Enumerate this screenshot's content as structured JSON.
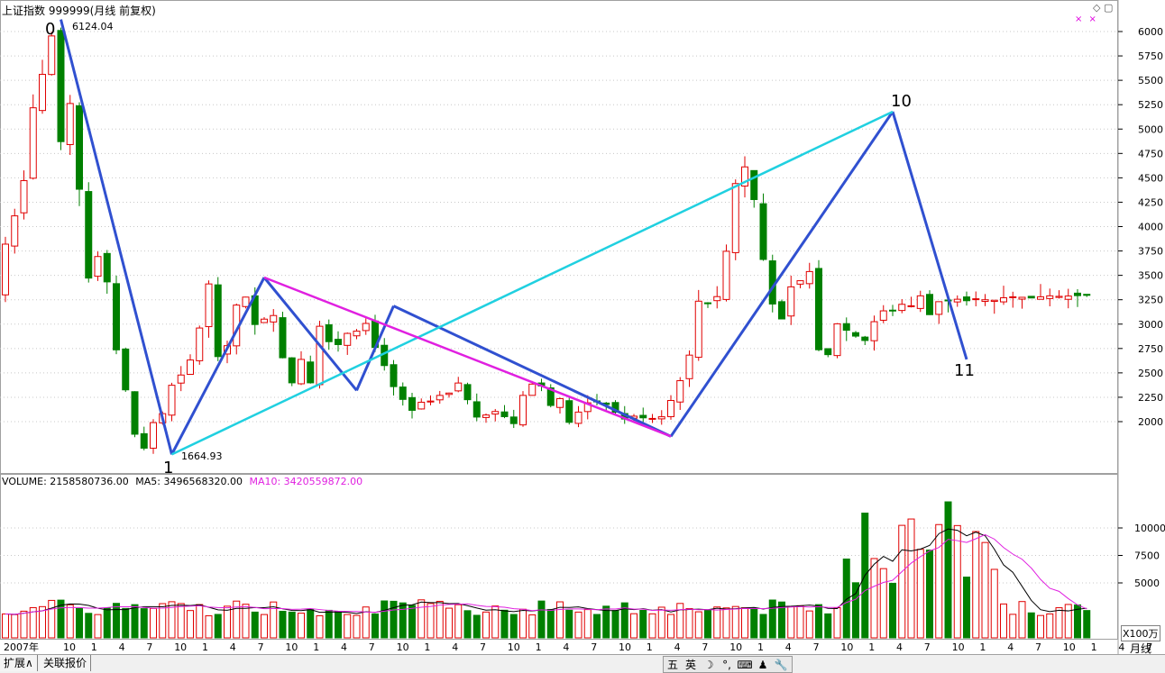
{
  "header": {
    "title": "上证指数 999999(月线 前复权)",
    "window_icons": "◇ ▢",
    "marker_glyph": "× ×"
  },
  "price_axis": {
    "ticks": [
      2000,
      2250,
      2500,
      2750,
      3000,
      3250,
      3500,
      3750,
      4000,
      4250,
      4500,
      4750,
      5000,
      5250,
      5500,
      5750,
      6000
    ],
    "min": 1500,
    "max": 6300
  },
  "volume_axis": {
    "ticks": [
      "5000",
      "7500",
      "10000"
    ],
    "unit": "X100万"
  },
  "volume_info": {
    "volume": "VOLUME: 2158580736.00",
    "ma5": "MA5: 3496568320.00",
    "ma10": "MA10: 3420559872.00"
  },
  "x_axis": {
    "labels": [
      "2007年",
      "10",
      "1",
      "4",
      "7",
      "10",
      "1",
      "4",
      "7",
      "10",
      "1",
      "4",
      "7",
      "10",
      "1",
      "4",
      "7",
      "10",
      "1",
      "4",
      "7",
      "10",
      "1",
      "4",
      "7",
      "10",
      "1",
      "4",
      "7",
      "10",
      "1",
      "4",
      "7",
      "10",
      "1",
      "4",
      "7",
      "10",
      "1",
      "4",
      "7",
      "10",
      "1"
    ]
  },
  "annotations": {
    "high_label": "6124.04",
    "low_label": "1664.93",
    "wave_labels": [
      "0",
      "1",
      "10",
      "11"
    ]
  },
  "period": "月线",
  "bottom_tabs": [
    "扩展∧",
    "关联报价"
  ],
  "ime": [
    "五",
    "英",
    "☽",
    "°,",
    "⌨",
    "♟",
    "🔧"
  ],
  "colors": {
    "up": "#e00000",
    "down": "#008000",
    "wave": "#3050d0",
    "cyan": "#20d0e0",
    "magenta": "#e020e0",
    "ma5": "#000000",
    "ma10": "#e020e0"
  },
  "chart_data": {
    "type": "candlestick",
    "months": 118,
    "closes": [
      3820,
      4110,
      4471,
      5218,
      5561,
      5955,
      4871,
      5262,
      4383,
      3472,
      3693,
      3433,
      2736,
      2326,
      1871,
      1728,
      1990,
      2082,
      2373,
      2478,
      2632,
      2960,
      3412,
      2667,
      2779,
      3195,
      3277,
      2996,
      3051,
      3088,
      2655,
      2398,
      2638,
      2398,
      2978,
      2820,
      2790,
      2905,
      2928,
      3007,
      2761,
      2575,
      2359,
      2228,
      2116,
      2199,
      2211,
      2269,
      2293,
      2396,
      2225,
      2047,
      2068,
      2104,
      2051,
      1980,
      2269,
      2385,
      2365,
      2166,
      2236,
      1993,
      2098,
      2193,
      2203,
      2176,
      2097,
      2027,
      2056,
      2039,
      2033,
      2050,
      2217,
      2420,
      2682,
      3235,
      3210,
      3282,
      3747,
      4441,
      4612,
      4277,
      3663,
      3206,
      3053,
      3382,
      3445,
      3539,
      2737,
      2687,
      3003,
      2937,
      2877,
      2832,
      3025,
      3136,
      3140,
      3203,
      3188,
      3290,
      3097,
      3230,
      3245,
      3255,
      3240,
      3260,
      3250,
      3245,
      3270,
      3280,
      3275,
      3268,
      3280,
      3290,
      3285,
      3288,
      3292,
      3295
    ]
  }
}
